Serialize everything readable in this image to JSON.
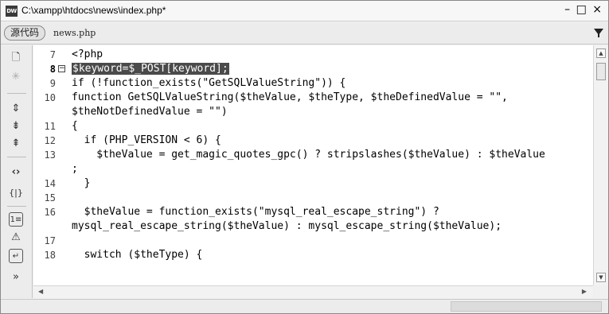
{
  "window": {
    "title": "C:\\xampp\\htdocs\\news\\index.php*",
    "app_icon_label": "DW",
    "minimize_glyph": "–",
    "maximize_glyph": "□",
    "close_glyph": "×"
  },
  "tabs": {
    "source_label": "源代码",
    "file_label": "news.php"
  },
  "toolbar": {
    "icons": [
      "open-documents-icon",
      "show-code-navigator-icon",
      "collapse-full-tag-icon",
      "collapse-selection-icon",
      "expand-all-icon",
      "select-parent-tag-icon",
      "balance-braces-icon",
      "line-numbers-icon",
      "highlight-invalid-code-icon",
      "word-wrap-icon",
      "more-tools-icon"
    ],
    "glyphs": [
      "🗋",
      "✳",
      "⇕",
      "⇟",
      "⇞",
      "‹›",
      "{|}",
      "1≡",
      "⚠",
      "↵",
      "»"
    ]
  },
  "code": {
    "lines": [
      {
        "num": "7",
        "text": "<?php",
        "current": false
      },
      {
        "num": "8",
        "text": "$keyword=$_POST[keyword];",
        "current": true
      },
      {
        "num": "9",
        "text": "if (!function_exists(\"GetSQLValueString\")) {",
        "current": false
      },
      {
        "num": "10",
        "text": "function GetSQLValueString($theValue, $theType, $theDefinedValue = \"\",",
        "current": false
      },
      {
        "num": "",
        "text": "$theNotDefinedValue = \"\")",
        "current": false
      },
      {
        "num": "11",
        "text": "{",
        "current": false
      },
      {
        "num": "12",
        "text": "  if (PHP_VERSION < 6) {",
        "current": false
      },
      {
        "num": "13",
        "text": "    $theValue = get_magic_quotes_gpc() ? stripslashes($theValue) : $theValue",
        "current": false
      },
      {
        "num": "",
        "text": ";",
        "current": false
      },
      {
        "num": "14",
        "text": "  }",
        "current": false
      },
      {
        "num": "15",
        "text": "",
        "current": false
      },
      {
        "num": "16",
        "text": "  $theValue = function_exists(\"mysql_real_escape_string\") ?",
        "current": false
      },
      {
        "num": "",
        "text": "mysql_real_escape_string($theValue) : mysql_escape_string($theValue);",
        "current": false
      },
      {
        "num": "17",
        "text": "",
        "current": false
      },
      {
        "num": "18",
        "text": "  switch ($theType) {",
        "current": false
      }
    ]
  },
  "colors": {
    "highlight_bg": "#4a4a4a",
    "highlight_fg": "#ffffff"
  }
}
